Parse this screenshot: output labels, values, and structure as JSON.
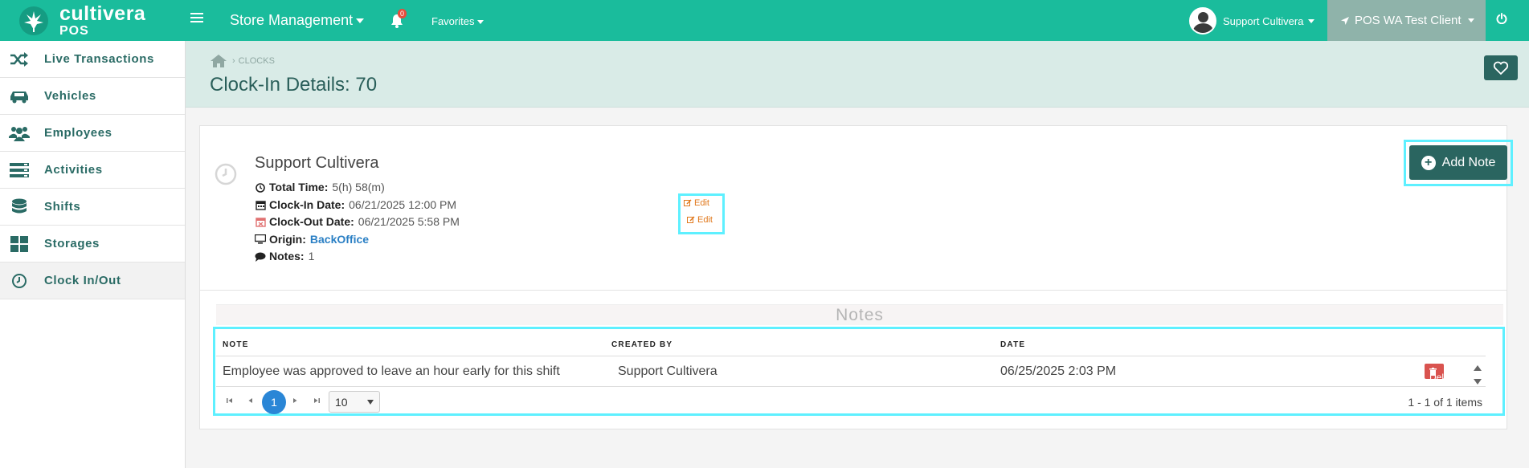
{
  "app": {
    "brand_name": "cultivera",
    "brand_sub": "POS"
  },
  "topbar": {
    "store_menu": "Store Management",
    "notification_count": "0",
    "favorites": "Favorites",
    "user_name": "Support Cultivera",
    "location": "POS WA Test Client"
  },
  "sidebar": {
    "items": [
      {
        "label": "Live Transactions",
        "icon": "shuffle-icon"
      },
      {
        "label": "Vehicles",
        "icon": "car-icon"
      },
      {
        "label": "Employees",
        "icon": "users-icon"
      },
      {
        "label": "Activities",
        "icon": "list-icon"
      },
      {
        "label": "Shifts",
        "icon": "database-icon"
      },
      {
        "label": "Storages",
        "icon": "grid-icon"
      },
      {
        "label": "Clock In/Out",
        "icon": "clock-icon",
        "active": true
      }
    ]
  },
  "header": {
    "breadcrumb": "CLOCKS",
    "title": "Clock-In Details: 70"
  },
  "details": {
    "name": "Support Cultivera",
    "total_time_label": "Total Time:",
    "total_time": "5(h) 58(m)",
    "clock_in_label": "Clock-In Date:",
    "clock_in": "06/21/2025 12:00 PM",
    "clock_out_label": "Clock-Out Date:",
    "clock_out": "06/21/2025 5:58 PM",
    "origin_label": "Origin:",
    "origin": "BackOffice",
    "notes_label": "Notes:",
    "notes_count": "1",
    "edit_label": "Edit"
  },
  "add_note_label": "Add Note",
  "notes": {
    "title": "Notes",
    "columns": [
      "NOTE",
      "CREATED BY",
      "DATE"
    ],
    "rows": [
      {
        "note": "Employee was approved to leave an hour early for this shift",
        "created_by": "Support Cultivera",
        "date": "06/25/2025 2:03 PM",
        "action": "Delete"
      }
    ],
    "pager": {
      "current_page": "1",
      "page_size": "10",
      "info": "1 - 1 of 1 items"
    }
  },
  "colors": {
    "topbar": "#1abc9c",
    "accent_dark": "#2a6560",
    "highlight": "#5ef0ff",
    "delete": "#d9534f",
    "edit": "#e0781c"
  }
}
